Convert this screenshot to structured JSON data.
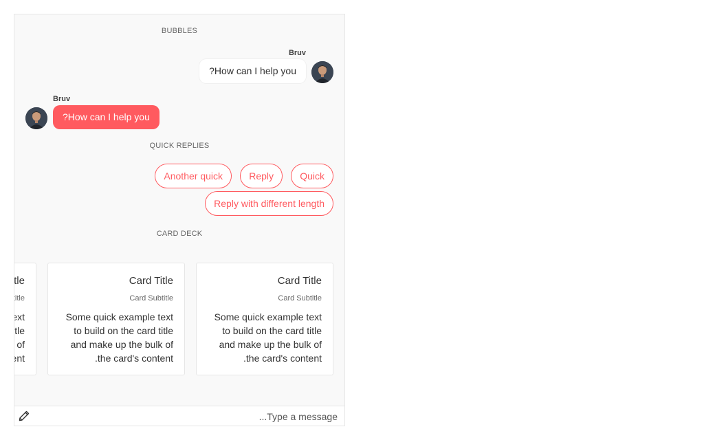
{
  "sections": {
    "bubbles": "BUBBLES",
    "quick_replies": "QUICK REPLIES",
    "card_deck": "CARD DECK"
  },
  "messages": [
    {
      "author": "Bruv",
      "text": "How can I help you?",
      "side": "right",
      "style": "white"
    },
    {
      "author": "Bruv",
      "text": "How can I help you?",
      "side": "left",
      "style": "accent"
    }
  ],
  "quick_replies": [
    "Another quick",
    "Reply",
    "Quick",
    "Reply with different length"
  ],
  "cards": [
    {
      "title": "Card Title",
      "subtitle": "Card Subtitle",
      "text": "Some quick example text to build on the card title and make up the bulk of the card's content."
    },
    {
      "title": "Card Title",
      "subtitle": "Card Subtitle",
      "text": "Some quick example text to build on the card title and make up the bulk of the card's content."
    },
    {
      "title": "Card Title",
      "subtitle": "Card Subtitle",
      "text": "Some quick example text to build on the card title and make up the bulk of the card's content."
    }
  ],
  "composer": {
    "placeholder": "Type a message..."
  },
  "icons": {
    "composer": "pencil-icon",
    "avatar": "user-avatar"
  },
  "colors": {
    "accent": "#ff5a5f",
    "background": "#f9f9f9",
    "card_border": "#e6e6e6"
  }
}
